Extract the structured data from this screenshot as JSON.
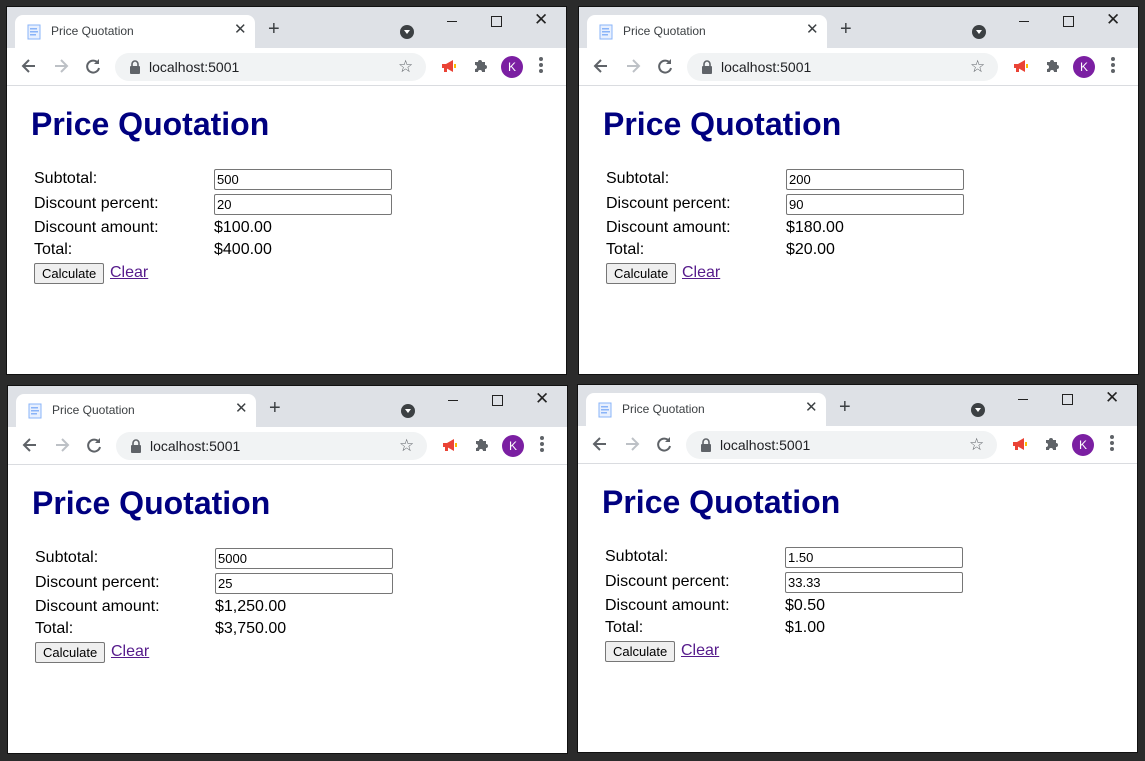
{
  "windows": [
    {
      "tab_title": "Price Quotation",
      "url": "localhost:5001",
      "avatar_letter": "K",
      "heading": "Price Quotation",
      "subtotal_label": "Subtotal:",
      "discount_percent_label": "Discount percent:",
      "discount_amount_label": "Discount amount:",
      "total_label": "Total:",
      "subtotal_value": "500",
      "discount_percent_value": "20",
      "discount_amount": "$100.00",
      "total": "$400.00",
      "calculate_label": "Calculate",
      "clear_label": "Clear"
    },
    {
      "tab_title": "Price Quotation",
      "url": "localhost:5001",
      "avatar_letter": "K",
      "heading": "Price Quotation",
      "subtotal_label": "Subtotal:",
      "discount_percent_label": "Discount percent:",
      "discount_amount_label": "Discount amount:",
      "total_label": "Total:",
      "subtotal_value": "200",
      "discount_percent_value": "90",
      "discount_amount": "$180.00",
      "total": "$20.00",
      "calculate_label": "Calculate",
      "clear_label": "Clear"
    },
    {
      "tab_title": "Price Quotation",
      "url": "localhost:5001",
      "avatar_letter": "K",
      "heading": "Price Quotation",
      "subtotal_label": "Subtotal:",
      "discount_percent_label": "Discount percent:",
      "discount_amount_label": "Discount amount:",
      "total_label": "Total:",
      "subtotal_value": "5000",
      "discount_percent_value": "25",
      "discount_amount": "$1,250.00",
      "total": "$3,750.00",
      "calculate_label": "Calculate",
      "clear_label": "Clear"
    },
    {
      "tab_title": "Price Quotation",
      "url": "localhost:5001",
      "avatar_letter": "K",
      "heading": "Price Quotation",
      "subtotal_label": "Subtotal:",
      "discount_percent_label": "Discount percent:",
      "discount_amount_label": "Discount amount:",
      "total_label": "Total:",
      "subtotal_value": "1.50",
      "discount_percent_value": "33.33",
      "discount_amount": "$0.50",
      "total": "$1.00",
      "calculate_label": "Calculate",
      "clear_label": "Clear"
    }
  ],
  "colors": {
    "heading": "#000080",
    "link_visited": "#551a8b",
    "avatar": "#7b1fa2",
    "extension_megaphone": "#ea4335"
  },
  "icons": [
    "page-favicon-icon",
    "close-icon",
    "plus-icon",
    "tab-search-icon",
    "minimize-icon",
    "maximize-icon",
    "back-arrow-icon",
    "forward-arrow-icon",
    "reload-icon",
    "lock-icon",
    "star-icon",
    "megaphone-icon",
    "puzzle-icon",
    "kebab-menu-icon"
  ]
}
